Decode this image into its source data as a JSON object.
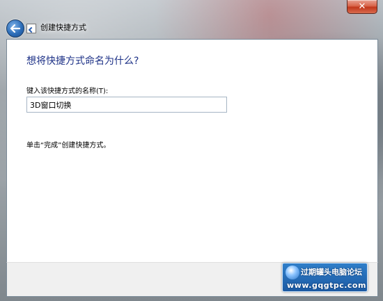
{
  "window": {
    "close_label": "✕",
    "title": "创建快捷方式"
  },
  "wizard": {
    "heading": "想将快捷方式命名为什么?",
    "field_label": "键入该快捷方式的名称(T):",
    "name_value": "3D窗口切换",
    "hint": "单击“完成”创建快捷方式。"
  },
  "watermark": {
    "title": "过期罐头电脑论坛",
    "url": "www.gqgtpc.com"
  },
  "icons": {
    "back": "back-arrow-icon",
    "wizard": "shortcut-wizard-icon",
    "close": "close-icon",
    "logo": "forum-logo-icon"
  },
  "colors": {
    "heading": "#1e3287",
    "close_button": "#c1371b",
    "back_button": "#2c6db8",
    "watermark_bg": "#1c5aa3"
  }
}
